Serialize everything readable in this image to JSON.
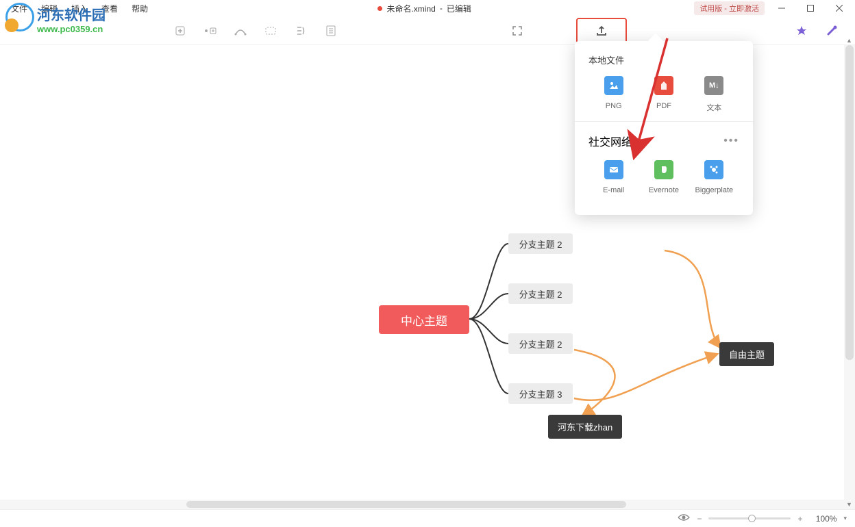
{
  "menu": {
    "file": "文件",
    "edit": "编辑",
    "insert": "插入",
    "view": "查看",
    "help": "帮助"
  },
  "title": {
    "filename": "未命名.xmind",
    "sep": "-",
    "status": "已编辑"
  },
  "trial_label": "试用版 - 立即激活",
  "logo": {
    "cn": "河东软件园",
    "url": "www.pc0359.cn"
  },
  "mindmap": {
    "central": "中心主题",
    "branches": [
      "分支主题 2",
      "分支主题 2",
      "分支主题 2",
      "分支主题 3"
    ],
    "float1": "自由主题",
    "float2": "河东下载zhan"
  },
  "popover": {
    "local_title": "本地文件",
    "local_items": [
      {
        "label": "PNG",
        "icon": "png"
      },
      {
        "label": "PDF",
        "icon": "pdf"
      },
      {
        "label": "文本",
        "icon": "txt"
      }
    ],
    "social_title": "社交网络",
    "social_items": [
      {
        "label": "E-mail",
        "icon": "email"
      },
      {
        "label": "Evernote",
        "icon": "evernote"
      },
      {
        "label": "Biggerplate",
        "icon": "bigger"
      }
    ],
    "more": "•••"
  },
  "status": {
    "zoom": "100%"
  }
}
